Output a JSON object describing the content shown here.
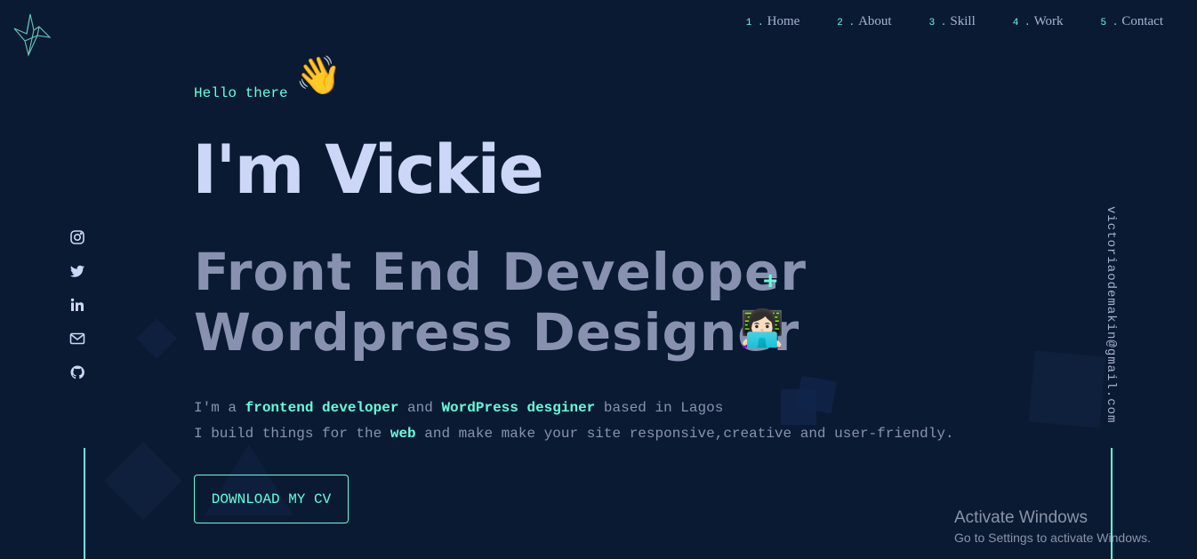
{
  "colors": {
    "background": "#0b1a33",
    "accent": "#64ffda",
    "heading": "#ccd6f6",
    "muted": "#8892b0"
  },
  "logo": {
    "icon": "crane-origami-icon"
  },
  "nav": {
    "items": [
      {
        "num": "1 .",
        "label": "Home"
      },
      {
        "num": "2 .",
        "label": "About"
      },
      {
        "num": "3 .",
        "label": "Skill"
      },
      {
        "num": "4 .",
        "label": "Work"
      },
      {
        "num": "5 .",
        "label": "Contact"
      }
    ]
  },
  "social": {
    "icons": [
      "instagram-icon",
      "twitter-icon",
      "linkedin-icon",
      "mail-icon",
      "github-icon"
    ]
  },
  "email": "victoriaodemakin@gmail.com",
  "hero": {
    "greeting": "Hello there",
    "wave_emoji": "👋",
    "name": "I'm Vickie",
    "role_line1": "Front End Developer",
    "plus": "+",
    "role_line2": "Wordpress Designer",
    "laptop_emoji": "👩🏻‍💻",
    "desc1": {
      "p1": "I'm a ",
      "h1": "frontend developer",
      "p2": " and ",
      "h2": "WordPress desginer",
      "p3": " based in Lagos"
    },
    "desc2": {
      "p1": "I build things for the ",
      "h1": "web",
      "p2": " and make make your site responsive,creative and user-friendly."
    },
    "cv_button": "DOWNLOAD MY CV"
  },
  "watermark": {
    "title": "Activate Windows",
    "subtitle": "Go to Settings to activate Windows."
  }
}
